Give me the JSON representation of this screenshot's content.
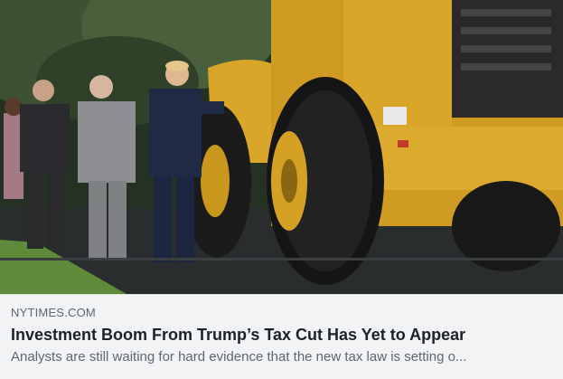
{
  "link_preview": {
    "domain": "NYTIMES.COM",
    "headline": "Investment Boom From Trump’s Tax Cut Has Yet to Appear",
    "description": "Analysts are still waiting for hard evidence that the new tax law is setting o..."
  },
  "colors": {
    "meta_background": "#f2f3f5",
    "domain_text": "#606770",
    "headline_text": "#1d2129",
    "machine_yellow": "#d8a526"
  }
}
